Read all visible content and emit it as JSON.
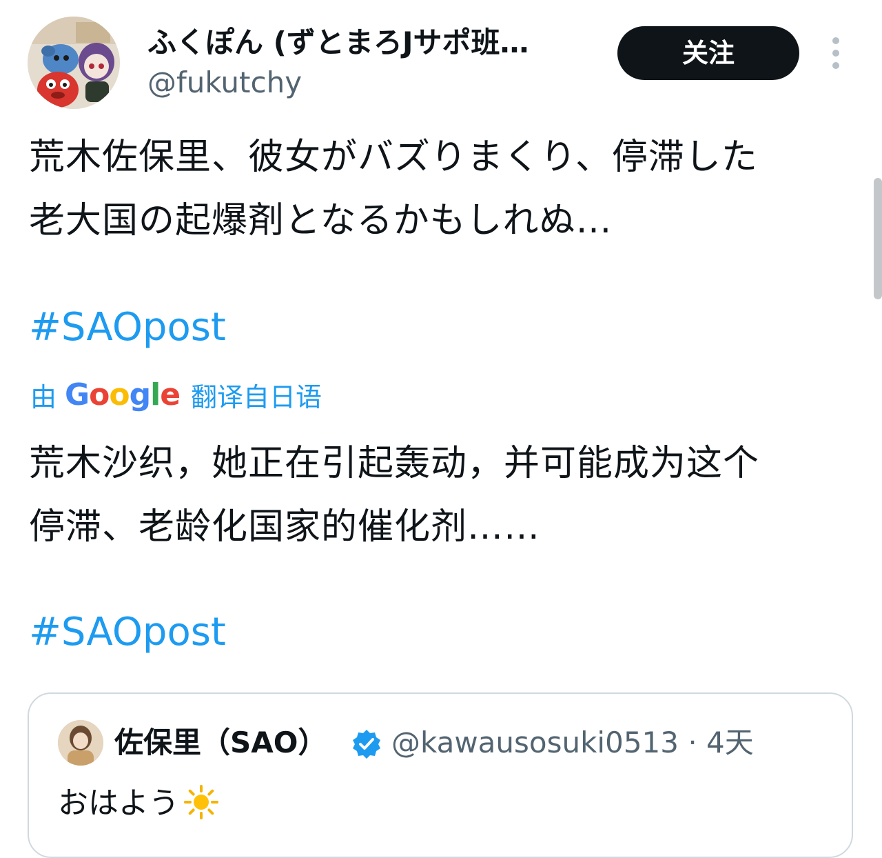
{
  "author": {
    "display_name": "ふくぽん (ずとまろJサポ班…",
    "handle": "@fukutchy",
    "avatar_icon": "plush-toys-avatar"
  },
  "follow_button": {
    "label": "关注"
  },
  "more_options_icon": "more-vertical-icon",
  "original_text": {
    "line1": "荒木佐保里、彼女がバズりまくり、停滞した",
    "line2": "老大国の起爆剤となるかもしれぬ…"
  },
  "hashtag_original": "#SAOpost",
  "translation": {
    "prefix": "由",
    "provider_letters": [
      "G",
      "o",
      "o",
      "g",
      "l",
      "e"
    ],
    "suffix": "翻译自日语",
    "line1": "荒木沙织，她正在引起轰动，并可能成为这个",
    "line2": "停滞、老龄化国家的催化剂……"
  },
  "hashtag_translated": "#SAOpost",
  "quoted_post": {
    "display_name": "佐保里（SAO）",
    "verified_icon": "verified-badge-icon",
    "handle_time": "@kawausosuki0513 · 4天",
    "text": "おはよう",
    "emoji_icon": "sun-icon"
  },
  "colors": {
    "link": "#1d9bf0",
    "text": "#0f1419",
    "secondary_text": "#536471",
    "button_bg": "#0f1419",
    "border": "#cfd9de"
  }
}
